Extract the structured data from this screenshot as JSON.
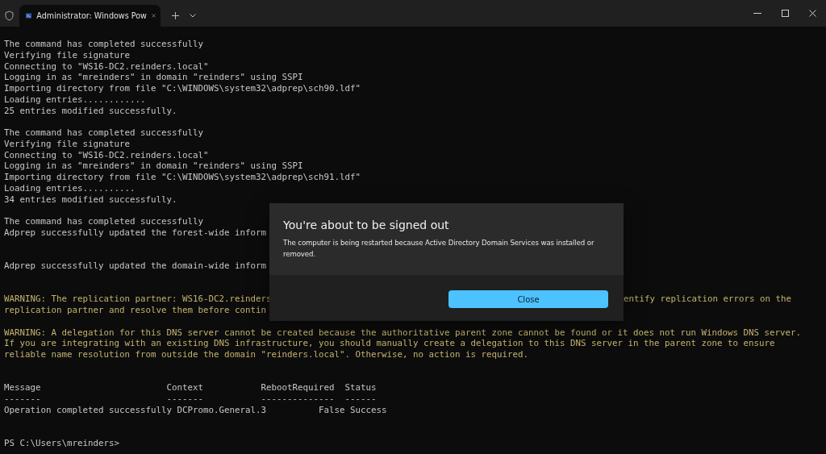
{
  "window": {
    "tab": {
      "title": "Administrator: Windows Pow",
      "selected": true
    }
  },
  "terminal": {
    "lines": [
      {
        "kind": "normal",
        "text": "The command has completed successfully"
      },
      {
        "kind": "normal",
        "text": "Verifying file signature"
      },
      {
        "kind": "normal",
        "text": "Connecting to \"WS16-DC2.reinders.local\""
      },
      {
        "kind": "normal",
        "text": "Logging in as \"mreinders\" in domain \"reinders\" using SSPI"
      },
      {
        "kind": "normal",
        "text": "Importing directory from file \"C:\\WINDOWS\\system32\\adprep\\sch90.ldf\""
      },
      {
        "kind": "normal",
        "text": "Loading entries............"
      },
      {
        "kind": "normal",
        "text": "25 entries modified successfully."
      },
      {
        "kind": "blank"
      },
      {
        "kind": "normal",
        "text": "The command has completed successfully"
      },
      {
        "kind": "normal",
        "text": "Verifying file signature"
      },
      {
        "kind": "normal",
        "text": "Connecting to \"WS16-DC2.reinders.local\""
      },
      {
        "kind": "normal",
        "text": "Logging in as \"mreinders\" in domain \"reinders\" using SSPI"
      },
      {
        "kind": "normal",
        "text": "Importing directory from file \"C:\\WINDOWS\\system32\\adprep\\sch91.ldf\""
      },
      {
        "kind": "normal",
        "text": "Loading entries.........."
      },
      {
        "kind": "normal",
        "text": "34 entries modified successfully."
      },
      {
        "kind": "blank"
      },
      {
        "kind": "normal",
        "text": "The command has completed successfully"
      },
      {
        "kind": "normal",
        "text": "Adprep successfully updated the forest-wide inform"
      },
      {
        "kind": "blank"
      },
      {
        "kind": "blank"
      },
      {
        "kind": "normal",
        "text": "Adprep successfully updated the domain-wide inform"
      },
      {
        "kind": "blank"
      },
      {
        "kind": "blank"
      },
      {
        "kind": "warning",
        "text": "WARNING: The replication partner: WS16-DC2.reinders",
        "right": "entify replication errors on the"
      },
      {
        "kind": "warning",
        "text": "replication partner and resolve them before contin"
      },
      {
        "kind": "blank"
      },
      {
        "kind": "warning",
        "text": "WARNING: A delegation for this DNS server cannot be created because the authoritative parent zone cannot be found or it does not run Windows DNS server."
      },
      {
        "kind": "warning",
        "text": "If you are integrating with an existing DNS infrastructure, you should manually create a delegation to this DNS server in the parent zone to ensure"
      },
      {
        "kind": "warning",
        "text": "reliable name resolution from outside the domain \"reinders.local\". Otherwise, no action is required."
      },
      {
        "kind": "blank"
      },
      {
        "kind": "blank"
      },
      {
        "kind": "normal",
        "text": "Message                        Context           RebootRequired  Status"
      },
      {
        "kind": "normal",
        "text": "-------                        -------           --------------  ------"
      },
      {
        "kind": "normal",
        "text": "Operation completed successfully DCPromo.General.3          False Success"
      },
      {
        "kind": "blank"
      },
      {
        "kind": "blank"
      },
      {
        "kind": "normal",
        "text": "PS C:\\Users\\mreinders>"
      }
    ]
  },
  "dialog": {
    "title": "You're about to be signed out",
    "message": "The computer is being restarted because Active Directory Domain Services was installed or removed.",
    "button": "Close"
  }
}
